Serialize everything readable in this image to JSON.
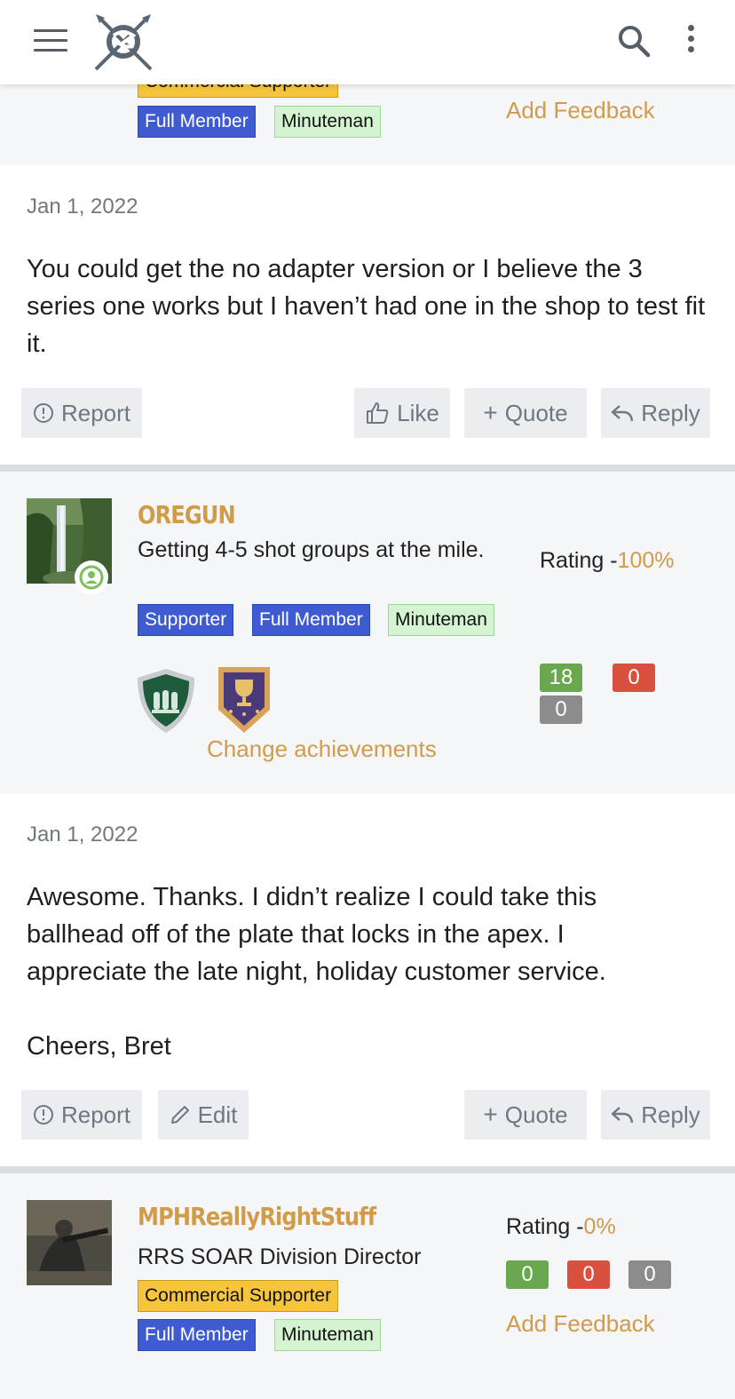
{
  "header": {
    "menu_icon": "hamburger-icon",
    "logo": "site-logo",
    "search_icon": "search-icon",
    "more_icon": "more-vertical-icon"
  },
  "prev_user": {
    "badges": [
      "Commercial Supporter",
      "Full Member",
      "Minuteman"
    ],
    "add_feedback": "Add Feedback"
  },
  "post1": {
    "date": "Jan 1, 2022",
    "text": "You could get the no adapter version or I believe the 3 series one works but I haven’t had one in the shop to test fit it.",
    "actions": {
      "report": "Report",
      "like": "Like",
      "quote": "Quote",
      "reply": "Reply"
    }
  },
  "user2": {
    "name": "OREGUN",
    "title": "Getting 4-5 shot groups at the mile.",
    "badges": [
      "Supporter",
      "Full Member",
      "Minuteman"
    ],
    "rating_label": "Rating -",
    "rating_value": "100%",
    "feedback": {
      "positive": "18",
      "negative": "0",
      "neutral": "0"
    },
    "change_achievements": "Change achievements"
  },
  "post2": {
    "date": "Jan 1, 2022",
    "text_lines": [
      "Awesome. Thanks. I didn’t realize I could take this",
      "ballhead off of the plate that locks in the apex. I",
      "appreciate the late night, holiday customer service."
    ],
    "signoff": "Cheers, Bret",
    "actions": {
      "report": "Report",
      "edit": "Edit",
      "quote": "Quote",
      "reply": "Reply"
    }
  },
  "user3": {
    "name": "MPHReallyRightStuff",
    "title": "RRS SOAR Division Director",
    "badges": [
      "Commercial Supporter",
      "Full Member",
      "Minuteman"
    ],
    "rating_label": "Rating -",
    "rating_value": "0%",
    "feedback": {
      "positive": "0",
      "negative": "0",
      "neutral": "0"
    },
    "add_feedback": "Add Feedback"
  },
  "colors": {
    "accent": "#d19b4a",
    "full_member": "#3f5bd1",
    "minuteman": "#d4f4d1",
    "commercial": "#f6c53b",
    "positive": "#69a84f",
    "negative": "#d9503f",
    "neutral": "#8c8c8c"
  }
}
